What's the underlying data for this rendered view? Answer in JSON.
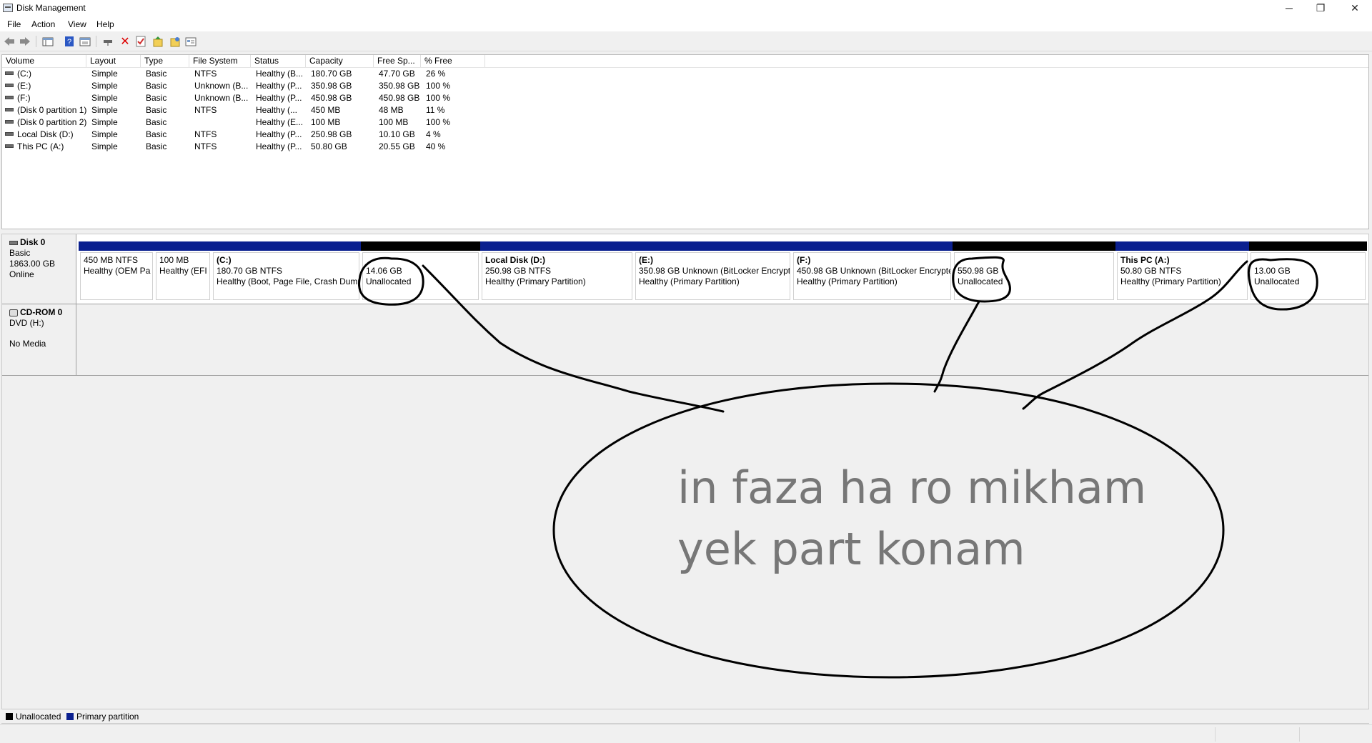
{
  "window": {
    "title": "Disk Management",
    "controls": [
      "─",
      "❐",
      "✕"
    ]
  },
  "menu": [
    "File",
    "Action",
    "View",
    "Help"
  ],
  "toolbar_icons": [
    "back-arrow-icon",
    "forward-arrow-icon",
    "sep",
    "console-tree-icon",
    "help-icon",
    "properties-icon",
    "sep",
    "connect-icon",
    "delete-icon",
    "check-icon",
    "rescan-icon",
    "refresh-icon",
    "settings-icon"
  ],
  "volume_list": {
    "columns": [
      "Volume",
      "Layout",
      "Type",
      "File System",
      "Status",
      "Capacity",
      "Free Sp...",
      "% Free"
    ],
    "rows": [
      [
        "(C:)",
        "Simple",
        "Basic",
        "NTFS",
        "Healthy (B...",
        "180.70 GB",
        "47.70 GB",
        "26 %"
      ],
      [
        "(E:)",
        "Simple",
        "Basic",
        "Unknown (B...",
        "Healthy (P...",
        "350.98 GB",
        "350.98 GB",
        "100 %"
      ],
      [
        "(F:)",
        "Simple",
        "Basic",
        "Unknown (B...",
        "Healthy (P...",
        "450.98 GB",
        "450.98 GB",
        "100 %"
      ],
      [
        "(Disk 0 partition 1)",
        "Simple",
        "Basic",
        "NTFS",
        "Healthy (...",
        "450 MB",
        "48 MB",
        "11 %"
      ],
      [
        "(Disk 0 partition 2)",
        "Simple",
        "Basic",
        "",
        "Healthy (E...",
        "100 MB",
        "100 MB",
        "100 %"
      ],
      [
        "Local Disk (D:)",
        "Simple",
        "Basic",
        "NTFS",
        "Healthy (P...",
        "250.98 GB",
        "10.10 GB",
        "4 %"
      ],
      [
        "This PC (A:)",
        "Simple",
        "Basic",
        "NTFS",
        "Healthy (P...",
        "50.80 GB",
        "20.55 GB",
        "40 %"
      ]
    ]
  },
  "disk0": {
    "name": "Disk 0",
    "type": "Basic",
    "size": "1863.00 GB",
    "state": "Online",
    "partitions": [
      {
        "kind": "primary",
        "title": "",
        "line1": "450 MB NTFS",
        "line2": "Healthy (OEM Pa"
      },
      {
        "kind": "primary",
        "title": "",
        "line1": "100 MB",
        "line2": "Healthy (EFI"
      },
      {
        "kind": "primary",
        "title": "(C:)",
        "line1": "180.70 GB NTFS",
        "line2": "Healthy (Boot, Page File, Crash Dump"
      },
      {
        "kind": "unalloc",
        "title": "",
        "line1": "14.06 GB",
        "line2": "Unallocated"
      },
      {
        "kind": "primary",
        "title": "Local Disk  (D:)",
        "line1": "250.98 GB NTFS",
        "line2": "Healthy (Primary Partition)"
      },
      {
        "kind": "primary",
        "title": "(E:)",
        "line1": "350.98 GB Unknown (BitLocker Encrypt",
        "line2": "Healthy (Primary Partition)"
      },
      {
        "kind": "primary",
        "title": "(F:)",
        "line1": "450.98 GB Unknown (BitLocker Encrypte",
        "line2": "Healthy (Primary Partition)"
      },
      {
        "kind": "unalloc",
        "title": "",
        "line1": "550.98 GB",
        "line2": "Unallocated"
      },
      {
        "kind": "primary",
        "title": "This PC  (A:)",
        "line1": "50.80 GB NTFS",
        "line2": "Healthy (Primary Partition)"
      },
      {
        "kind": "unalloc",
        "title": "",
        "line1": "13.00 GB",
        "line2": "Unallocated"
      }
    ]
  },
  "cdrom0": {
    "name": "CD-ROM 0",
    "drive": "DVD (H:)",
    "media": "No Media"
  },
  "legend": [
    {
      "label": "Unallocated",
      "color": "#000000"
    },
    {
      "label": "Primary partition",
      "color": "#0a1f8f"
    }
  ],
  "annotation": {
    "line1": "in faza ha ro mikham",
    "line2": "yek part konam"
  }
}
